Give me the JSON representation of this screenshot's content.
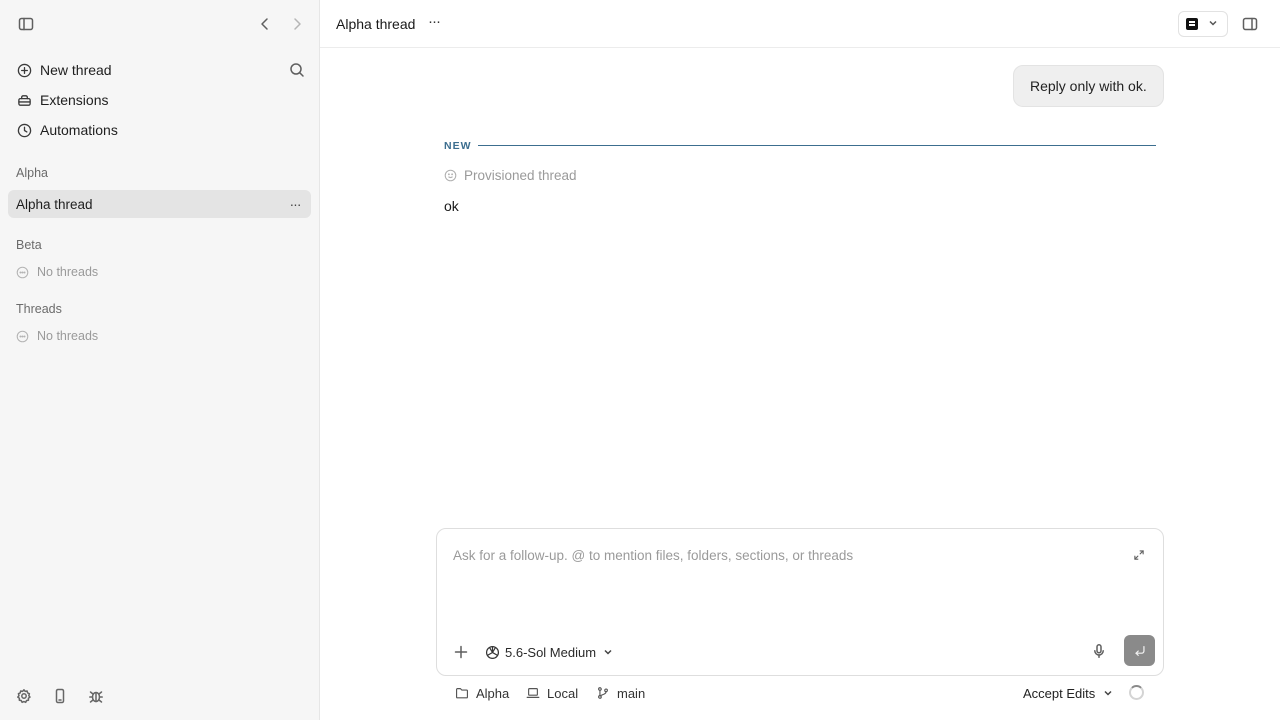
{
  "sidebar": {
    "nav": [
      {
        "label": "New thread",
        "icon": "plus-circle-icon"
      },
      {
        "label": "Extensions",
        "icon": "extensions-icon"
      },
      {
        "label": "Automations",
        "icon": "clock-icon"
      }
    ],
    "groups": [
      {
        "name": "Alpha",
        "threads": [
          {
            "label": "Alpha thread",
            "active": true
          }
        ]
      },
      {
        "name": "Beta",
        "empty_label": "No threads"
      },
      {
        "name": "Threads",
        "empty_label": "No threads"
      }
    ]
  },
  "topbar": {
    "thread_title": "Alpha thread",
    "more_label": "···"
  },
  "conversation": {
    "user_message": "Reply only with ok.",
    "divider_label": "NEW",
    "status_text": "Provisioned thread",
    "assistant_reply": "ok"
  },
  "composer": {
    "placeholder": "Ask for a follow-up. @ to mention files, folders, sections, or threads",
    "value": "",
    "model_label": "5.6-Sol Medium"
  },
  "footer": {
    "project": "Alpha",
    "environment": "Local",
    "branch": "main",
    "accept_edits_label": "Accept Edits"
  },
  "colors": {
    "accent_divider": "#3c6e8f",
    "sidebar_bg": "#f6f6f6",
    "active_thread_bg": "#e4e4e4",
    "send_button_bg": "#8a8a8a"
  }
}
